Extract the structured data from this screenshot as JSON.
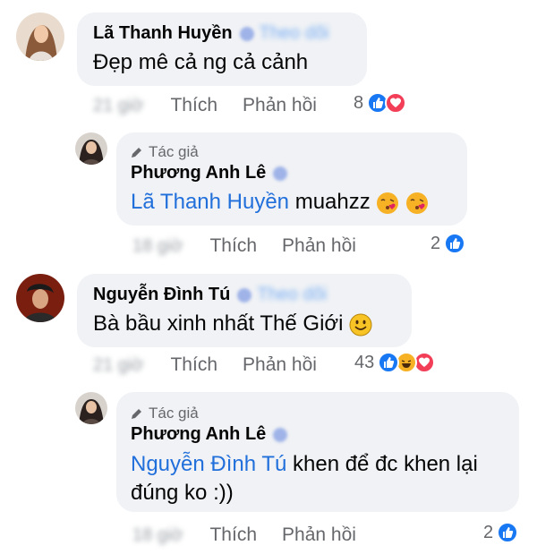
{
  "comments": [
    {
      "name": "Lã Thanh Huyền",
      "follow": "Theo dõi",
      "text": "Đẹp mê cả ng cả cảnh",
      "time": "21 giờ",
      "like": "Thích",
      "reply": "Phản hồi",
      "reactions_count": "8",
      "reactions": [
        "like",
        "love"
      ]
    },
    {
      "author_badge": "Tác giả",
      "name": "Phương Anh Lê",
      "mention": "Lã Thanh Huyền",
      "text": "muahzz",
      "time": "18 giờ",
      "like": "Thích",
      "reply": "Phản hồi",
      "reactions_count": "2",
      "reactions": [
        "like"
      ]
    },
    {
      "name": "Nguyễn Đình Tú",
      "follow": "Theo dõi",
      "text": "Bà bầu xinh nhất Thế Giới",
      "time": "21 giờ",
      "like": "Thích",
      "reply": "Phản hồi",
      "reactions_count": "43",
      "reactions": [
        "like",
        "haha",
        "love"
      ]
    },
    {
      "author_badge": "Tác giả",
      "name": "Phương Anh Lê",
      "mention": "Nguyễn Đình Tú",
      "text": "khen để đc khen lại",
      "text2": "đúng ko :))",
      "time": "18 giờ",
      "like": "Thích",
      "reply": "Phản hồi",
      "reactions_count": "2",
      "reactions": [
        "like"
      ]
    }
  ],
  "colors": {
    "like": "#1877f2",
    "love": "#f33e58",
    "haha": "#f7b125",
    "mention": "#216fdb",
    "bubble": "#f0f2f5",
    "meta": "#65676b"
  }
}
